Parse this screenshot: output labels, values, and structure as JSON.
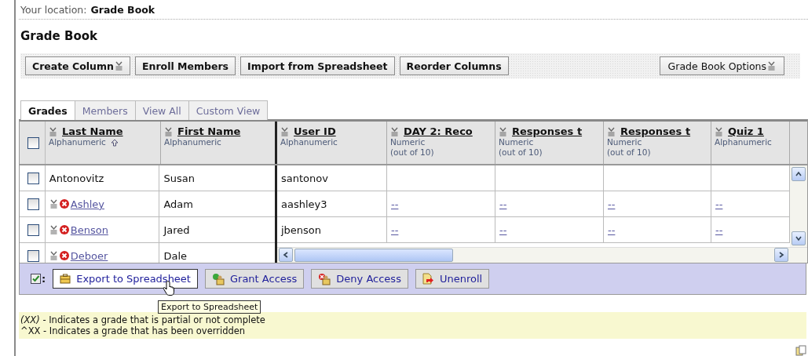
{
  "location": {
    "label": "Your location:",
    "value": "Grade Book"
  },
  "page_title": "Grade Book",
  "toolbar": {
    "buttons": [
      {
        "label": "Create Column",
        "dropdown": true
      },
      {
        "label": "Enroll Members",
        "dropdown": false
      },
      {
        "label": "Import from Spreadsheet",
        "dropdown": false
      },
      {
        "label": "Reorder Columns",
        "dropdown": false
      }
    ],
    "options_button": {
      "label": "Grade Book Options",
      "dropdown": true
    }
  },
  "tabs": [
    {
      "label": "Grades",
      "selected": true
    },
    {
      "label": "Members",
      "selected": false
    },
    {
      "label": "View All",
      "selected": false
    },
    {
      "label": "Custom View",
      "selected": false
    }
  ],
  "table": {
    "select_all": {
      "checked": false
    },
    "columns": [
      {
        "title": "Last Name",
        "type": "Alphanumeric",
        "sorted": true
      },
      {
        "title": "First Name",
        "type": "Alphanumeric",
        "sorted": false
      },
      {
        "title": "User ID",
        "type": "Alphanumeric",
        "sorted": false
      },
      {
        "title": "DAY 2: Reco",
        "type": "Numeric",
        "range": "(out of 10)",
        "sorted": false
      },
      {
        "title": "Responses t",
        "type": "Numeric",
        "range": "(out of 10)",
        "sorted": false
      },
      {
        "title": "Responses t",
        "type": "Numeric",
        "range": "(out of 10)",
        "sorted": false
      },
      {
        "title": "Quiz 1",
        "type": "Alphanumeric",
        "sorted": false
      }
    ],
    "rows": [
      {
        "checked": false,
        "kind": "plain",
        "last_name": "Antonovitz",
        "first_name": "Susan",
        "user_id": "santonov"
      },
      {
        "checked": false,
        "kind": "linked",
        "last_name": "Ashley",
        "first_name": "Adam",
        "user_id": "aashley3",
        "grades": [
          "--",
          "--",
          "--",
          "--"
        ]
      },
      {
        "checked": false,
        "kind": "linked",
        "last_name": "Benson",
        "first_name": "Jared",
        "user_id": "jbenson",
        "grades": [
          "--",
          "--",
          "--",
          "--"
        ]
      },
      {
        "checked": false,
        "kind": "linked",
        "last_name": "Deboer",
        "first_name": "Dale"
      }
    ]
  },
  "actions": {
    "selection_mark": ":",
    "buttons": [
      {
        "label": "Export to Spreadsheet",
        "kind": "export",
        "hovered": true
      },
      {
        "label": "Grant Access",
        "kind": "grant",
        "hovered": false
      },
      {
        "label": "Deny Access",
        "kind": "deny",
        "hovered": false
      },
      {
        "label": "Unenroll",
        "kind": "unenroll",
        "hovered": false
      }
    ],
    "tooltip": "Export to Spreadsheet"
  },
  "legend": [
    "*(XX)* - Indicates a grade that is partial or not complete",
    "^XX - Indicates a grade that has been overridden"
  ]
}
